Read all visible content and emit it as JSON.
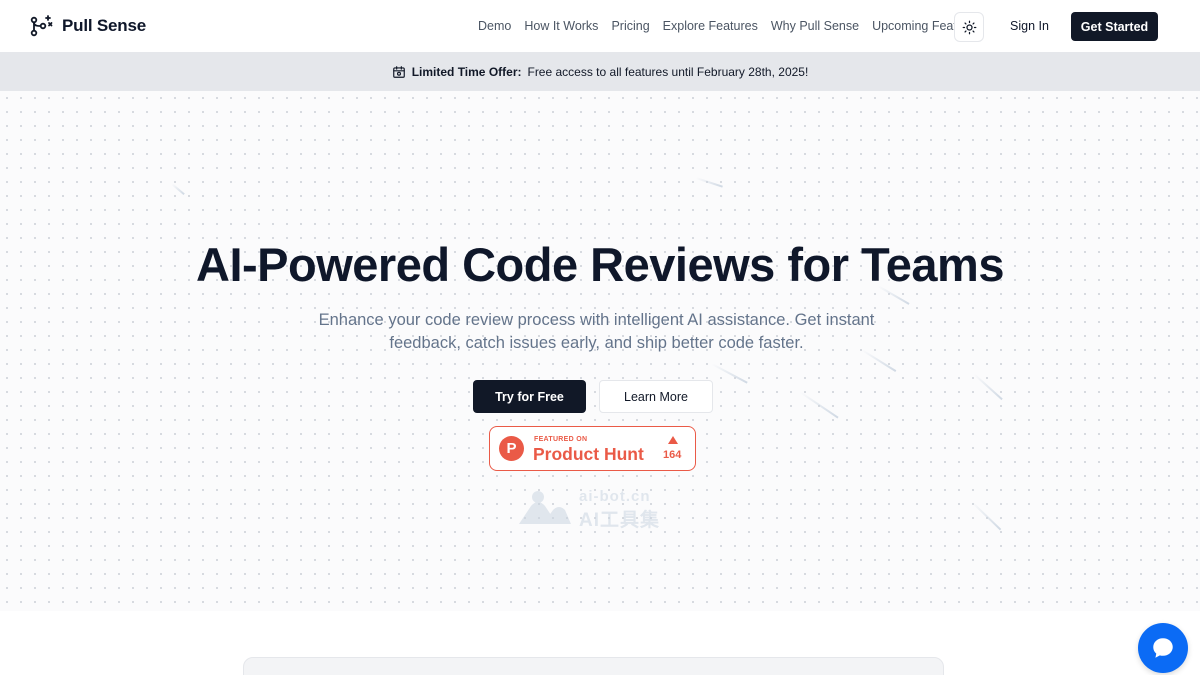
{
  "nav": {
    "brand": "Pull Sense",
    "brand_icon": "git-branch-sparkle-icon",
    "links": [
      "Demo",
      "How It Works",
      "Pricing",
      "Explore Features",
      "Why Pull Sense",
      "Upcoming Features"
    ],
    "theme_icon": "sun-icon",
    "sign_in": "Sign In",
    "get_started": "Get Started"
  },
  "banner": {
    "icon": "calendar-icon",
    "label": "Limited Time Offer:",
    "text": "Free access to all features until February 28th, 2025!"
  },
  "hero": {
    "headline": "AI-Powered Code Reviews for  Teams",
    "subtext": "Enhance your code review process with intelligent AI assistance. Get instant feedback, catch issues early, and ship better code faster.",
    "try_free": "Try for Free",
    "learn_more": "Learn More"
  },
  "product_hunt": {
    "letter": "P",
    "featured_on": "FEATURED ON",
    "name": "Product Hunt",
    "votes": "164",
    "color": "#ea5a47"
  },
  "watermark": {
    "top": "ai-bot.cn",
    "bottom": "AI工具集"
  },
  "chat": {
    "icon": "chat-bubble-icon",
    "color": "#0b6bf5"
  }
}
